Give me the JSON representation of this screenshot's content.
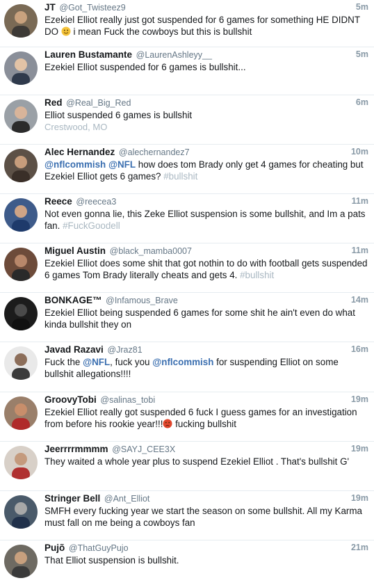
{
  "colors": {
    "name": "#14171a",
    "handle": "#657786",
    "time": "#8899a6",
    "mention": "#3b6fb0",
    "hashtag": "#aab8c2",
    "divider": "#e6ecf0"
  },
  "tweets": [
    {
      "name": "JT",
      "handle": "@Got_Twisteez9",
      "time": "5m",
      "avatar_icon": "avatar-photo-icon",
      "parts": [
        {
          "t": "Ezekiel Elliot really just got suspended for 6 games for something HE DIDNT DO "
        },
        {
          "emoji": "smiling-face-emoji"
        },
        {
          "t": " i mean Fuck the cowboys but this is bullshit"
        }
      ]
    },
    {
      "name": "Lauren Bustamante",
      "handle": "@LaurenAshleyy__",
      "time": "5m",
      "avatar_icon": "avatar-photo-icon",
      "parts": [
        {
          "t": "Ezekiel Elliot suspended for 6 games is bullshit..."
        }
      ]
    },
    {
      "name": "Red",
      "handle": "@Real_Big_Red",
      "time": "6m",
      "avatar_icon": "avatar-photo-icon",
      "parts": [
        {
          "t": "Elliot suspended 6 games is bullshit"
        }
      ],
      "location": "Crestwood, MO"
    },
    {
      "name": "Alec Hernandez",
      "handle": "@alechernandez7",
      "time": "10m",
      "avatar_icon": "avatar-photo-icon",
      "parts": [
        {
          "m": "@nflcommish"
        },
        {
          "t": " "
        },
        {
          "m": "@NFL"
        },
        {
          "t": " how does tom Brady only get 4 games for cheating but Ezekiel Elliot gets 6 games? "
        },
        {
          "h": "#bullshit"
        }
      ]
    },
    {
      "name": "Reece",
      "handle": "@reecea3",
      "time": "11m",
      "avatar_icon": "avatar-photo-icon",
      "parts": [
        {
          "t": "Not even gonna lie, this Zeke Elliot suspension is some bullshit, and Im a pats fan. "
        },
        {
          "h": "#FuckGoodell"
        }
      ]
    },
    {
      "name": "Miguel Austin",
      "handle": "@black_mamba0007",
      "time": "11m",
      "avatar_icon": "avatar-photo-icon",
      "parts": [
        {
          "t": "Ezekiel Elliot does some shit that got nothin to do with football gets suspended 6 games Tom Brady literally cheats and gets 4. "
        },
        {
          "h": "#bullshit"
        }
      ]
    },
    {
      "name": "BONKAGE™",
      "handle": "@Infamous_Brave",
      "time": "14m",
      "avatar_icon": "avatar-photo-icon",
      "parts": [
        {
          "t": "Ezekiel Elliot being suspended 6 games for some shit he ain't even do what kinda bullshit they on"
        }
      ]
    },
    {
      "name": "Javad Razavi",
      "handle": "@Jraz81",
      "time": "16m",
      "avatar_icon": "avatar-photo-icon",
      "parts": [
        {
          "t": "Fuck the "
        },
        {
          "m": "@NFL"
        },
        {
          "t": ", fuck you "
        },
        {
          "m": "@nflcommish"
        },
        {
          "t": " for suspending Elliot on some bullshit allegations!!!!"
        }
      ]
    },
    {
      "name": "GroovyTobi",
      "handle": "@salinas_tobi",
      "time": "19m",
      "avatar_icon": "avatar-photo-icon",
      "parts": [
        {
          "t": "Ezekiel Elliot really got suspended 6 fuck I guess games for an investigation from before his rookie year!!!"
        },
        {
          "emoji": "angry-face-emoji"
        },
        {
          "t": "  fucking bullshit"
        }
      ]
    },
    {
      "name": "Jeerrrrmmmm",
      "handle": "@SAYJ_CEE3X",
      "time": "19m",
      "avatar_icon": "avatar-photo-icon",
      "parts": [
        {
          "t": "They waited a whole year plus to suspend Ezekiel Elliot . That's bullshit G'"
        }
      ]
    },
    {
      "name": "Stringer Bell",
      "handle": "@Ant_Elliot",
      "time": "19m",
      "avatar_icon": "avatar-photo-icon",
      "parts": [
        {
          "t": "SMFH every fucking year we start the season on some bullshit. All my Karma must fall on me being a cowboys fan"
        }
      ]
    },
    {
      "name": "Pujõ",
      "handle": "@ThatGuyPujo",
      "time": "21m",
      "avatar_icon": "avatar-photo-icon",
      "parts": [
        {
          "t": "That Elliot suspension is bullshit."
        }
      ]
    }
  ]
}
